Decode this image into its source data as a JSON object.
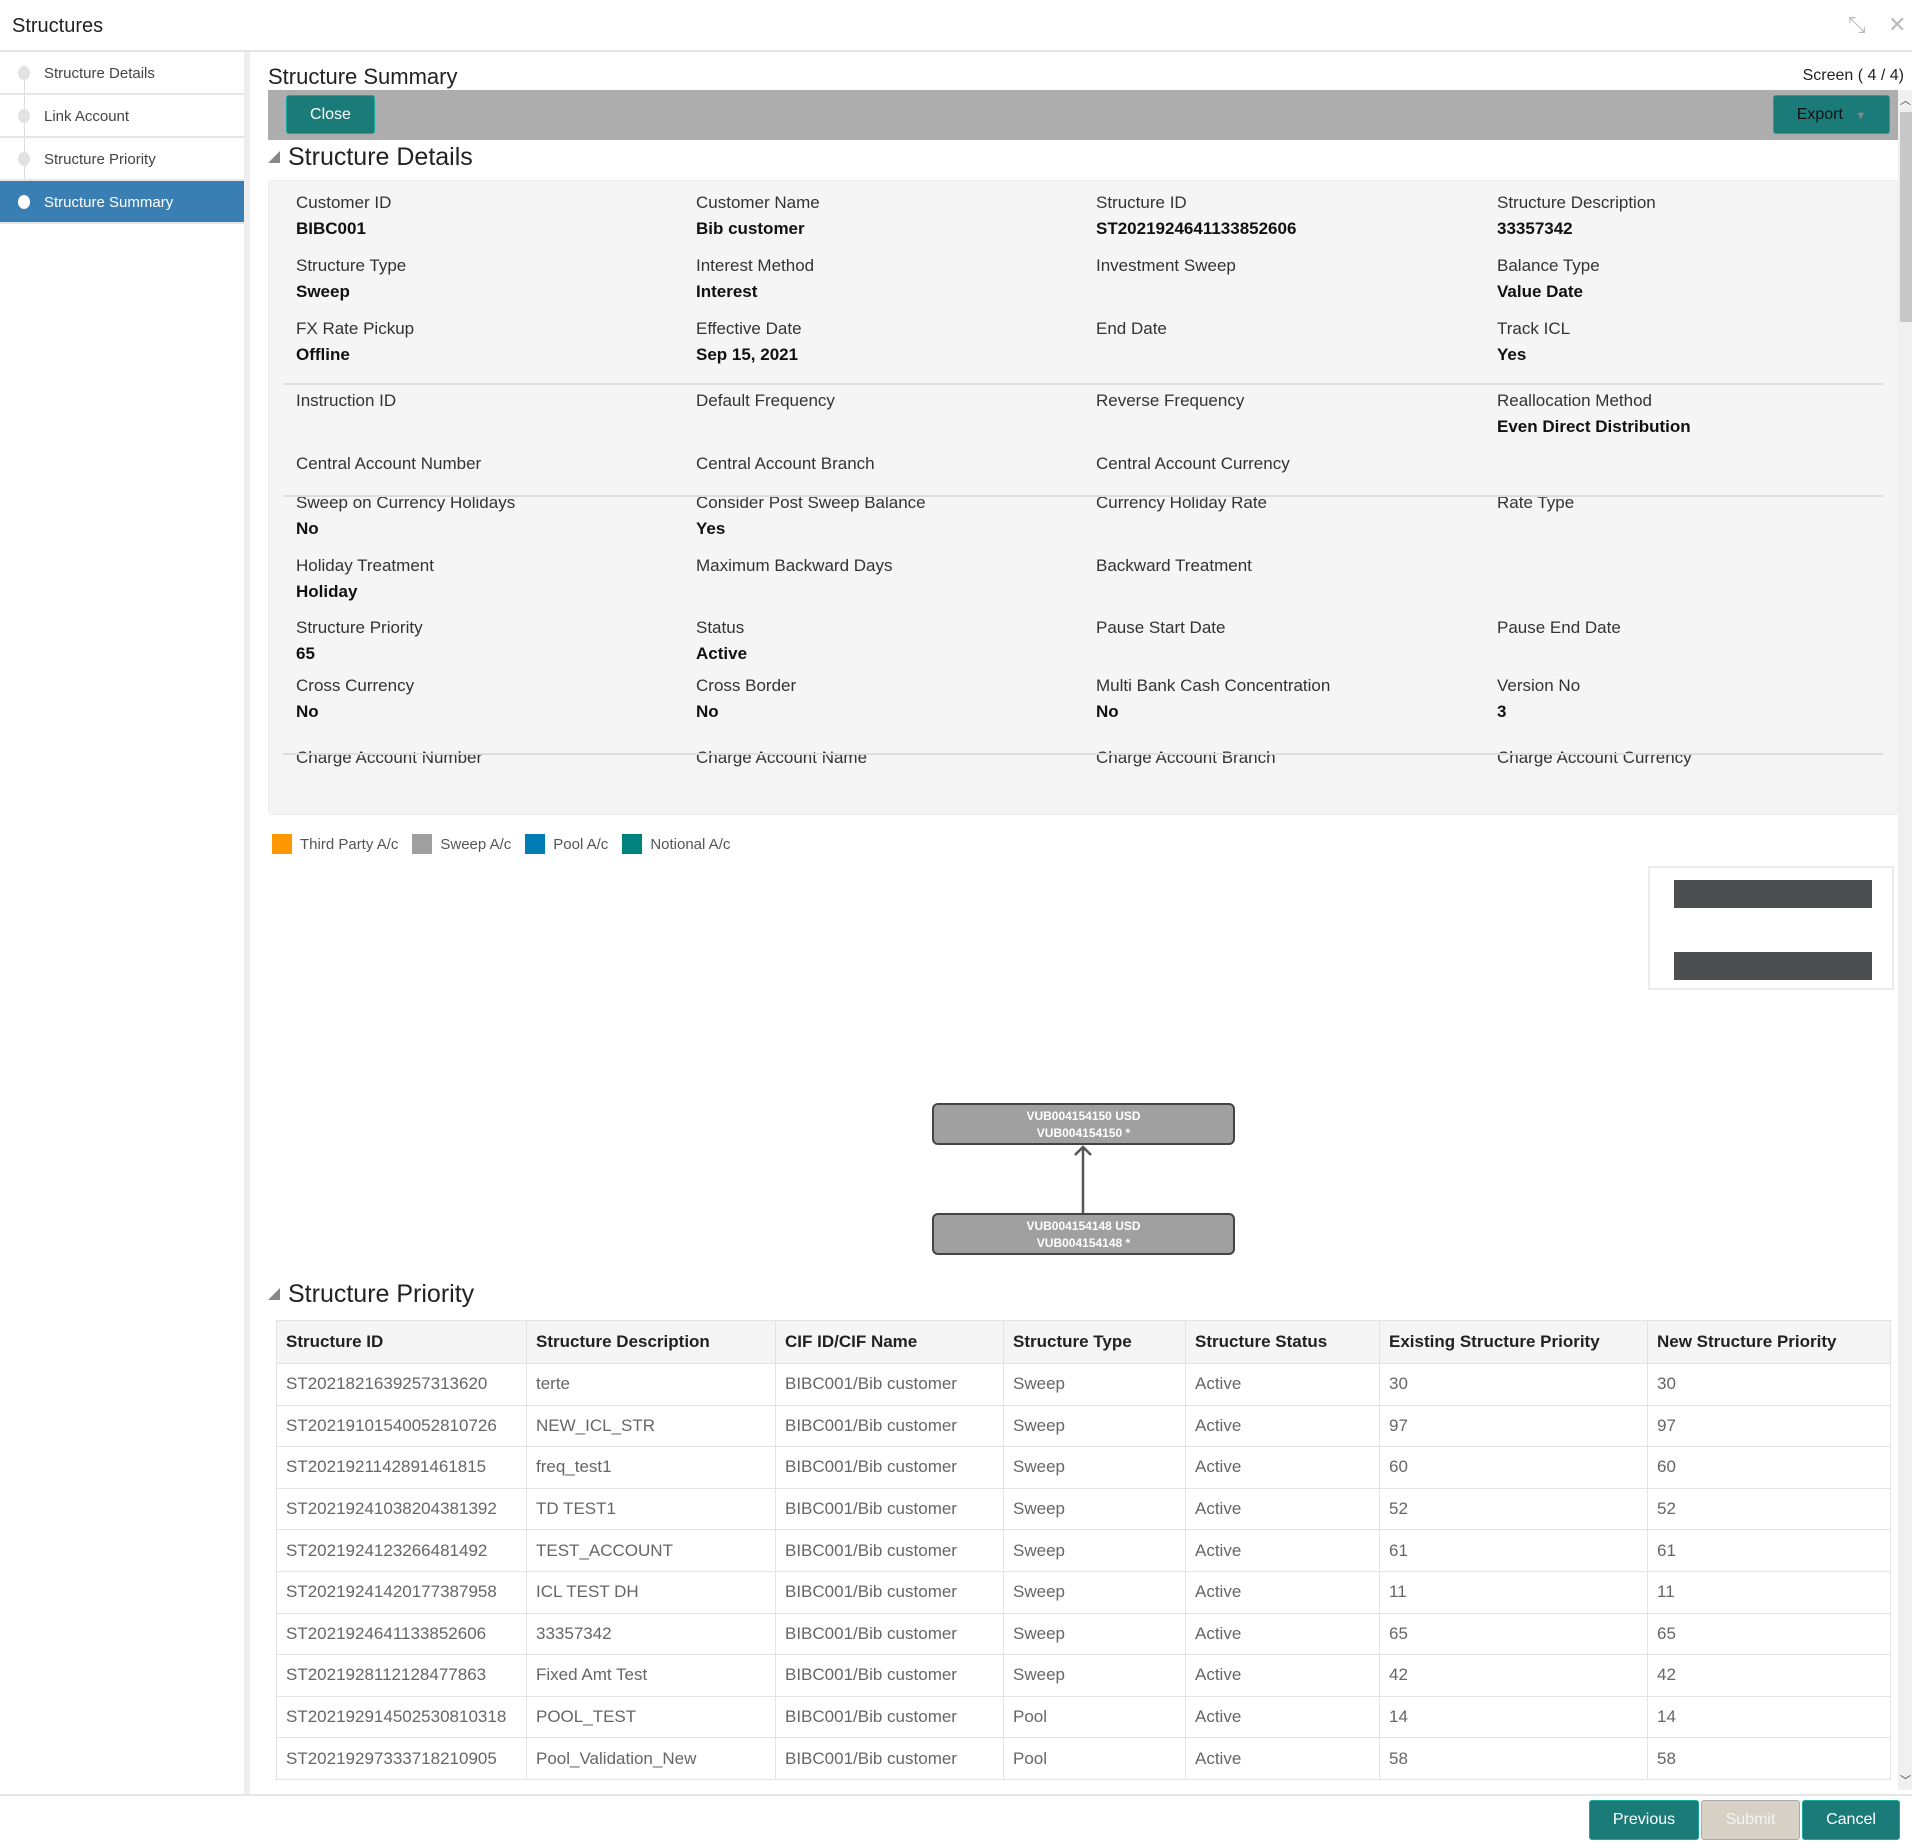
{
  "window": {
    "title": "Structures",
    "minimize_icon": "compress-icon",
    "close_icon": "close-icon"
  },
  "sidebar": {
    "items": [
      {
        "label": "Structure Details"
      },
      {
        "label": "Link Account"
      },
      {
        "label": "Structure Priority"
      },
      {
        "label": "Structure Summary",
        "active": true
      }
    ]
  },
  "page": {
    "title": "Structure Summary",
    "screen": "Screen ( 4 / 4)"
  },
  "toolbar": {
    "close": "Close",
    "export": "Export"
  },
  "details": {
    "title": "Structure Details",
    "fields": [
      {
        "label": "Customer ID",
        "value": "BIBC001"
      },
      {
        "label": "Customer Name",
        "value": "Bib customer"
      },
      {
        "label": "Structure ID",
        "value": "ST2021924641133852606"
      },
      {
        "label": "Structure Description",
        "value": "33357342"
      },
      {
        "label": "Structure Type",
        "value": "Sweep"
      },
      {
        "label": "Interest Method",
        "value": "Interest"
      },
      {
        "label": "Investment Sweep",
        "value": ""
      },
      {
        "label": "Balance Type",
        "value": "Value Date"
      },
      {
        "label": "FX Rate Pickup",
        "value": "Offline"
      },
      {
        "label": "Effective Date",
        "value": "Sep 15, 2021"
      },
      {
        "label": "End Date",
        "value": ""
      },
      {
        "label": "Track ICL",
        "value": "Yes"
      },
      {
        "label": "Instruction ID",
        "value": ""
      },
      {
        "label": "Default Frequency",
        "value": ""
      },
      {
        "label": "Reverse Frequency",
        "value": ""
      },
      {
        "label": "Reallocation Method",
        "value": "Even Direct Distribution"
      },
      {
        "label": "Central Account Number",
        "value": ""
      },
      {
        "label": "Central Account Branch",
        "value": ""
      },
      {
        "label": "Central Account Currency",
        "value": ""
      },
      {
        "label": "",
        "value": ""
      },
      {
        "label": "Sweep on Currency Holidays",
        "value": "No"
      },
      {
        "label": "Consider Post Sweep Balance",
        "value": "Yes"
      },
      {
        "label": "Currency Holiday Rate",
        "value": ""
      },
      {
        "label": "Rate Type",
        "value": ""
      },
      {
        "label": "Holiday Treatment",
        "value": "Holiday"
      },
      {
        "label": "Maximum Backward Days",
        "value": ""
      },
      {
        "label": "Backward Treatment",
        "value": ""
      },
      {
        "label": "",
        "value": ""
      },
      {
        "label": "Structure Priority",
        "value": "65"
      },
      {
        "label": "Status",
        "value": "Active"
      },
      {
        "label": "Pause Start Date",
        "value": ""
      },
      {
        "label": "Pause End Date",
        "value": ""
      },
      {
        "label": "Cross Currency",
        "value": "No"
      },
      {
        "label": "Cross Border",
        "value": "No"
      },
      {
        "label": "Multi Bank Cash Concentration",
        "value": "No"
      },
      {
        "label": "Version No",
        "value": "3"
      },
      {
        "label": "Charge Account Number",
        "value": ""
      },
      {
        "label": "Charge Account Name",
        "value": ""
      },
      {
        "label": "Charge Account Branch",
        "value": ""
      },
      {
        "label": "Charge Account Currency",
        "value": ""
      }
    ]
  },
  "legend": [
    {
      "label": "Third Party A/c",
      "color": "#ff9800"
    },
    {
      "label": "Sweep A/c",
      "color": "#a0a0a0"
    },
    {
      "label": "Pool A/c",
      "color": "#007cb5"
    },
    {
      "label": "Notional A/c",
      "color": "#00827f"
    }
  ],
  "diagram": {
    "nodes": [
      {
        "line1": "VUB004154150 USD",
        "line2": "VUB004154150 *"
      },
      {
        "line1": "VUB004154148 USD",
        "line2": "VUB004154148 *"
      }
    ]
  },
  "priority": {
    "title": "Structure Priority",
    "columns": [
      "Structure ID",
      "Structure Description",
      "CIF ID/CIF Name",
      "Structure Type",
      "Structure Status",
      "Existing Structure Priority",
      "New Structure Priority"
    ],
    "rows": [
      [
        "ST2021821639257313620",
        "terte",
        "BIBC001/Bib customer",
        "Sweep",
        "Active",
        "30",
        "30"
      ],
      [
        "ST2021910154005281072​6",
        "NEW_ICL_STR",
        "BIBC001/Bib customer",
        "Sweep",
        "Active",
        "97",
        "97"
      ],
      [
        "ST2021921142891461815",
        "freq_test1",
        "BIBC001/Bib customer",
        "Sweep",
        "Active",
        "60",
        "60"
      ],
      [
        "ST20219241038204381392",
        "TD TEST1",
        "BIBC001/Bib customer",
        "Sweep",
        "Active",
        "52",
        "52"
      ],
      [
        "ST2021924123266481492",
        "TEST_ACCOUNT",
        "BIBC001/Bib customer",
        "Sweep",
        "Active",
        "61",
        "61"
      ],
      [
        "ST20219241420177387958",
        "ICL TEST DH",
        "BIBC001/Bib customer",
        "Sweep",
        "Active",
        "11",
        "11"
      ],
      [
        "ST2021924641133852606",
        "33357342",
        "BIBC001/Bib customer",
        "Sweep",
        "Active",
        "65",
        "65"
      ],
      [
        "ST2021928112128477863",
        "Fixed Amt Test",
        "BIBC001/Bib customer",
        "Sweep",
        "Active",
        "42",
        "42"
      ],
      [
        "ST202192914502530810318",
        "POOL_TEST",
        "BIBC001/Bib customer",
        "Pool",
        "Active",
        "14",
        "14"
      ],
      [
        "ST20219297333718210905",
        "Pool_Validation_New",
        "BIBC001/Bib customer",
        "Pool",
        "Active",
        "58",
        "58"
      ]
    ]
  },
  "footer": {
    "previous": "Previous",
    "submit": "Submit",
    "cancel": "Cancel"
  }
}
